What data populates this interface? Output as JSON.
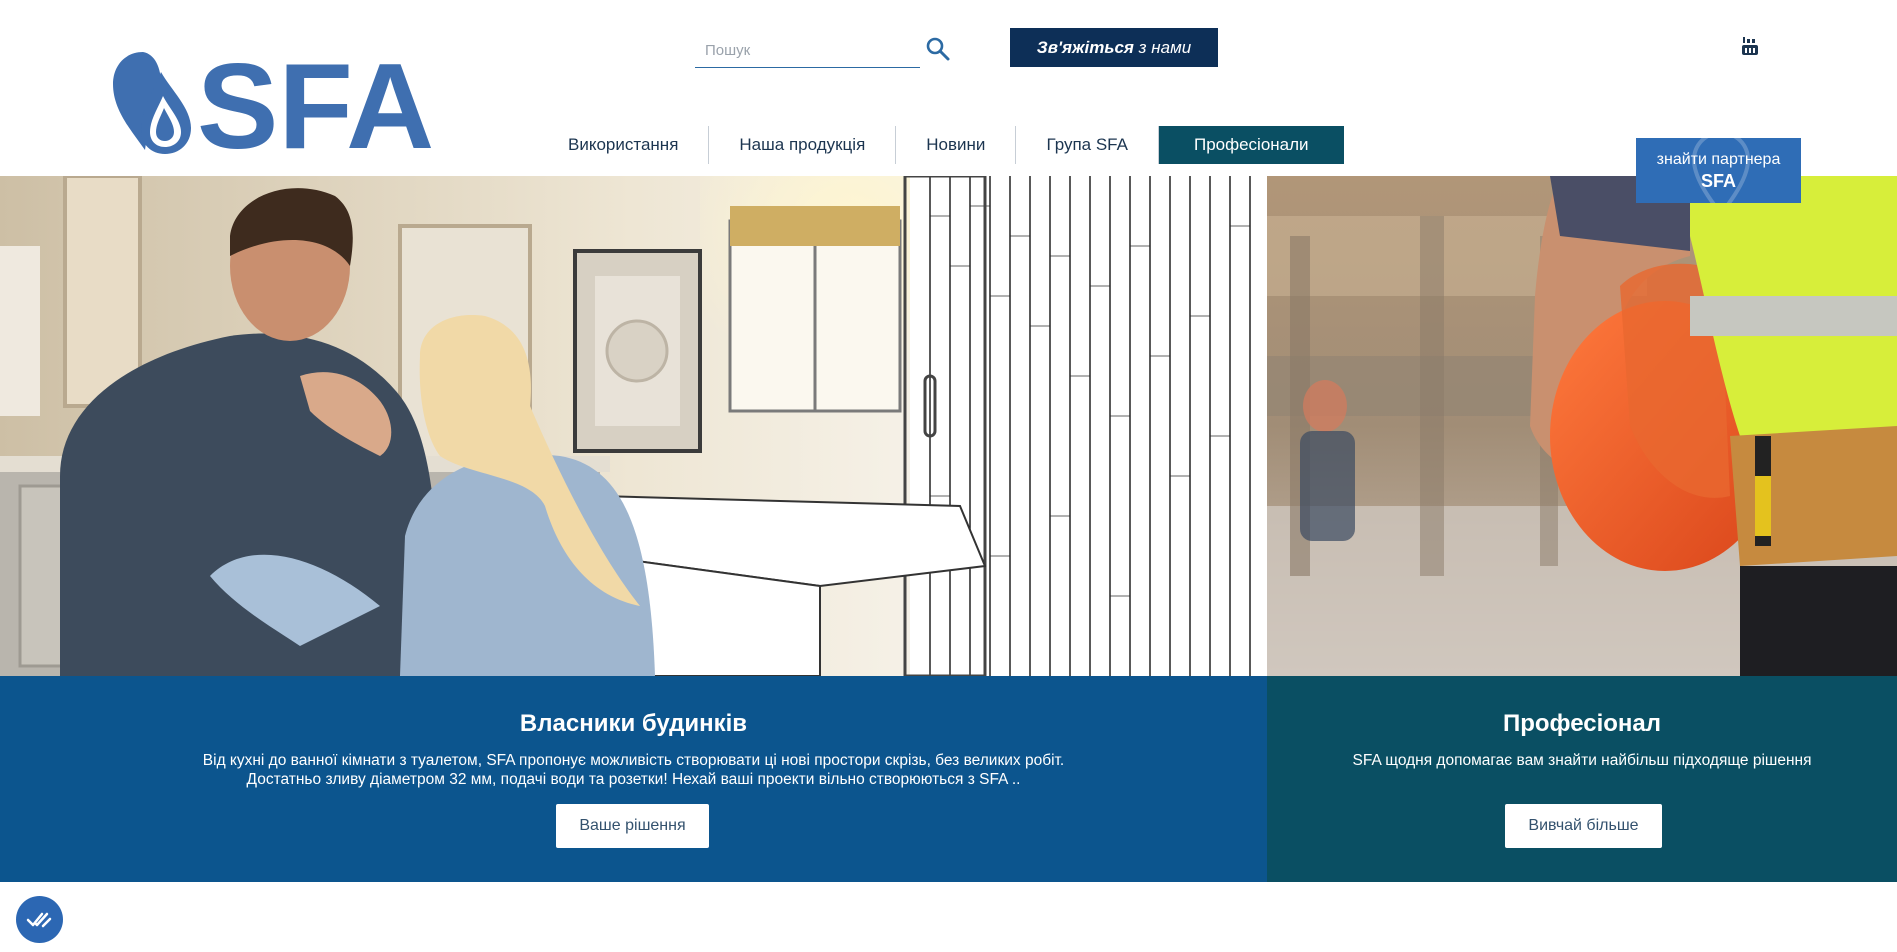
{
  "brand": {
    "logo_text": "SFA",
    "color": "#3f6fb0"
  },
  "search": {
    "placeholder": "Пошук",
    "icon": "search-icon"
  },
  "header": {
    "contact_bold": "Зв'яжіться",
    "contact_rest": " з нами",
    "social_icon": "youtube-icon",
    "partner_line1": "знайти партнера",
    "partner_line2": "SFA"
  },
  "nav": {
    "items": [
      {
        "label": "Використання",
        "active": false
      },
      {
        "label": "Наша продукція",
        "active": false
      },
      {
        "label": "Новини",
        "active": false
      },
      {
        "label": "Група SFA",
        "active": false
      },
      {
        "label": "Професіонали",
        "active": true
      }
    ]
  },
  "panels": {
    "owners": {
      "title": "Власники будинків",
      "text_line1": "Від кухні до ванної кімнати з туалетом, SFA пропонує можливість створювати ці нові простори скрізь, без великих робіт.",
      "text_line2": "Достатньо зливу діаметром 32 мм, подачі води та розетки! Нехай ваші проекти вільно створюються з SFA ..",
      "button": "Ваше рішення",
      "color": "#0c558e"
    },
    "pro": {
      "title": "Професіонал",
      "text_line1": "SFA щодня допомагає вам знайти найбільш підходяще рішення",
      "button": "Вивчай більше",
      "color": "#0a4f63"
    }
  },
  "cookie": {
    "icon": "double-check-icon",
    "color": "#2c67b3"
  },
  "colors": {
    "contact_bg": "#0d2f57",
    "nav_active_bg": "#0a4f63",
    "partner_bg": "#2f6db6"
  }
}
